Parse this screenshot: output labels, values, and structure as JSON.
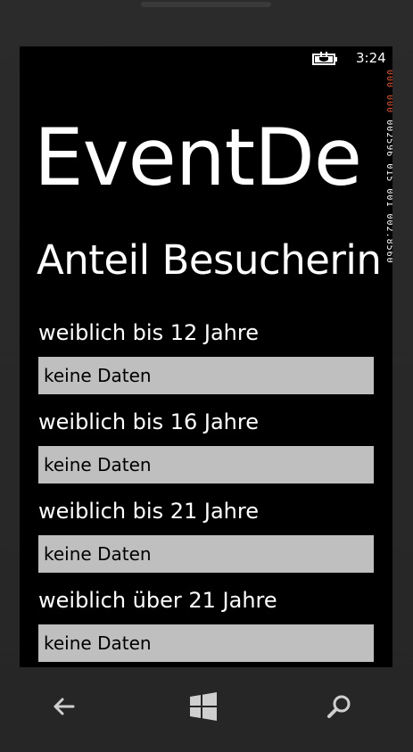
{
  "status_bar": {
    "time": "3:24"
  },
  "app": {
    "title": "EventDe",
    "page_title": "Anteil Besucherin"
  },
  "fields": [
    {
      "label": "weiblich bis 12 Jahre",
      "value": "keine Daten"
    },
    {
      "label": "weiblich bis 16 Jahre",
      "value": "keine Daten"
    },
    {
      "label": "weiblich bis 21 Jahre",
      "value": "keine Daten"
    },
    {
      "label": "weiblich über 21 Jahre",
      "value": "keine Daten"
    }
  ],
  "perf_counter": {
    "line1": "000",
    "line2": "000",
    "line3": "002596 015 001 002.8560"
  },
  "nav": {
    "back_icon": "back-arrow-icon",
    "start_icon": "windows-start-icon",
    "search_icon": "search-icon"
  },
  "colors": {
    "screen_bg": "#000000",
    "field_bg": "#bfbfbf",
    "counter_warn": "#e8502a"
  }
}
